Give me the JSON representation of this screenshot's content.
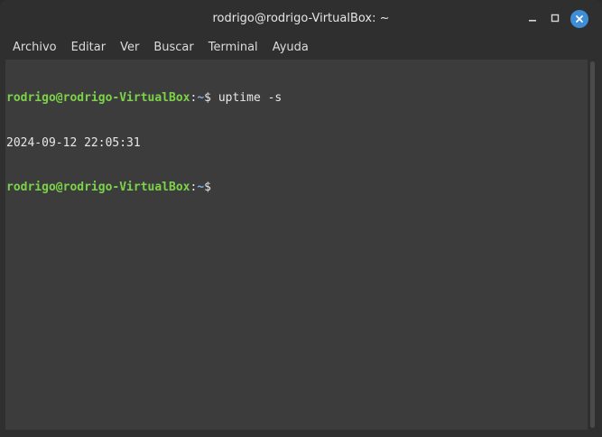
{
  "window": {
    "title": "rodrigo@rodrigo-VirtualBox: ~"
  },
  "menu": {
    "items": [
      "Archivo",
      "Editar",
      "Ver",
      "Buscar",
      "Terminal",
      "Ayuda"
    ]
  },
  "terminal": {
    "lines": [
      {
        "user": "rodrigo@rodrigo-VirtualBox",
        "sep": ":",
        "path": "~",
        "prompt": "$ ",
        "command": "uptime -s"
      },
      {
        "output": "2024-09-12 22:05:31"
      },
      {
        "user": "rodrigo@rodrigo-VirtualBox",
        "sep": ":",
        "path": "~",
        "prompt": "$ ",
        "command": ""
      }
    ]
  },
  "colors": {
    "user": "#7cd34a",
    "path": "#7ab2e6",
    "background": "#3c3c3c",
    "close_button": "#3e8ed6"
  },
  "icons": {
    "minimize": "minimize-icon",
    "maximize": "maximize-icon",
    "close": "close-icon"
  }
}
